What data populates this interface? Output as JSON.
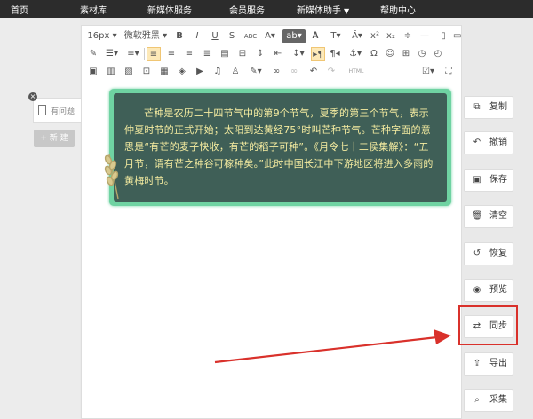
{
  "topnav": {
    "items": [
      "首页",
      "素材库",
      "新媒体服务",
      "会员服务",
      "新媒体助手",
      "帮助中心"
    ]
  },
  "tabs": {
    "doc_label": "有问题",
    "close": "×",
    "new_label": "+ 新 建"
  },
  "toolbar": {
    "font_size": "16px",
    "font_family": "微软雅黑",
    "bold": "B",
    "italic": "I",
    "underline": "U",
    "abc": "ABC",
    "font_a": "A",
    "ab": "ab",
    "undo_label": "HTML",
    "omega": "Ω"
  },
  "article": {
    "text": "芒种是农历二十四节气中的第9个节气，夏季的第三个节气，表示仲夏时节的正式开始；太阳到达黄经75°时叫芒种节气。芒种字面的意思是“有芒的麦子快收，有芒的稻子可种”。《月令七十二侯集解》：“五月节，谓有芒之种谷可稼种矣。”此时中国长江中下游地区将进入多雨的黄梅时节。"
  },
  "sidebar": {
    "buttons": [
      {
        "label": "复制",
        "icon": "copy-icon"
      },
      {
        "label": "撤销",
        "icon": "undo-icon"
      },
      {
        "label": "保存",
        "icon": "save-icon"
      },
      {
        "label": "清空",
        "icon": "trash-icon"
      },
      {
        "label": "恢复",
        "icon": "restore-icon"
      },
      {
        "label": "预览",
        "icon": "eye-icon"
      },
      {
        "label": "同步",
        "icon": "sync-icon"
      },
      {
        "label": "导出",
        "icon": "export-icon"
      },
      {
        "label": "采集",
        "icon": "search-icon"
      }
    ]
  },
  "colors": {
    "nav_bg": "#2c2c2c",
    "article_bg": "#3f5f57",
    "article_border": "#6fd3a2",
    "article_text": "#f5eca0",
    "highlight": "#d9312b"
  }
}
